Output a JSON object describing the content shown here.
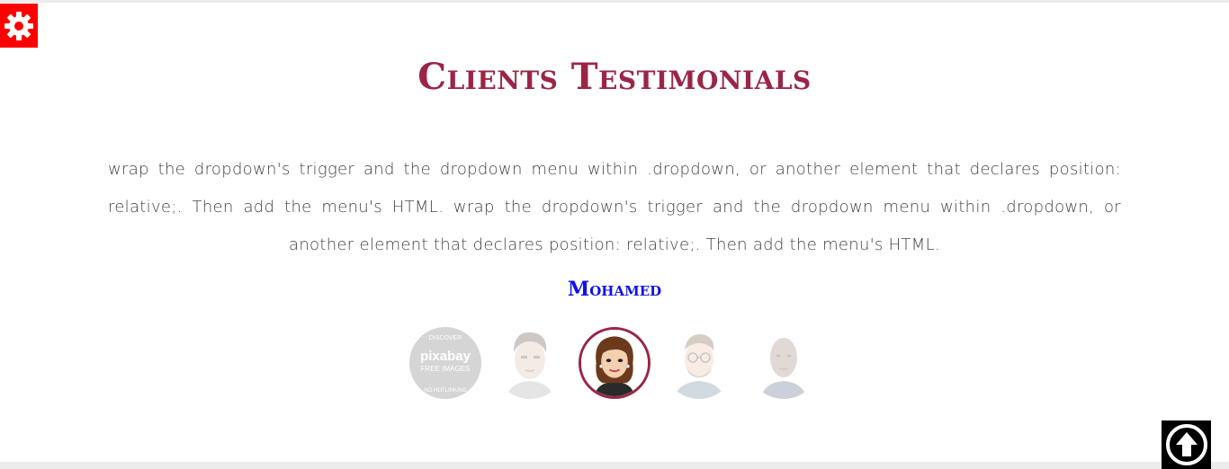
{
  "settings": {
    "icon": "gear-icon",
    "color": "#ff0000"
  },
  "section": {
    "title": "Clients Testimonials",
    "title_color": "#9b2546"
  },
  "testimonial": {
    "text": "wrap the dropdown's trigger and the dropdown menu within .dropdown, or another element that declares position: relative;. Then add the menu's HTML. wrap the dropdown's trigger and the dropdown menu within .dropdown, or another element that declares position: relative;. Then add the menu's HTML.",
    "client_name": "Mohamed",
    "client_name_color": "#1010ee"
  },
  "avatars": [
    {
      "name": "pixabay-placeholder",
      "top_text": "DISCOVER",
      "brand_text": "pixabay",
      "sub_text": "FREE IMAGES",
      "bottom_text": "NO HOTLINKING",
      "active": false
    },
    {
      "name": "man-cartoon",
      "active": false
    },
    {
      "name": "woman-cartoon",
      "active": true
    },
    {
      "name": "man-glasses-cartoon",
      "active": false
    },
    {
      "name": "bald-man-photo",
      "active": false
    }
  ],
  "scroll_top": {
    "icon": "arrow-up-circle-icon"
  }
}
